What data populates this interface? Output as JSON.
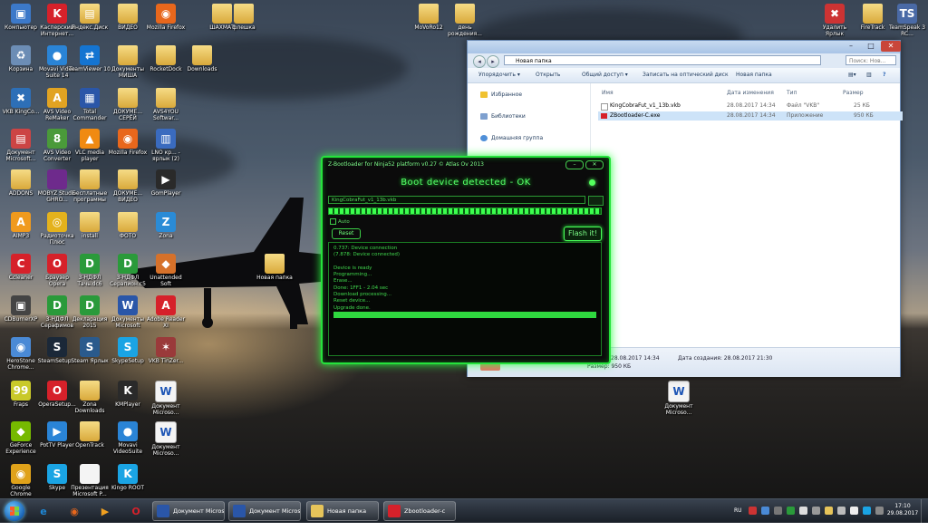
{
  "desktop": {
    "icons": [
      {
        "label": "Компьютер",
        "glyph": "▣",
        "color": "#3c79c9"
      },
      {
        "label": "Касперский Интернет...",
        "glyph": "K",
        "color": "#d6212a"
      },
      {
        "label": "Яндекс.Диск",
        "glyph": "▤",
        "color": "folder"
      },
      {
        "label": "ВИДЕО",
        "glyph": "",
        "color": "folder"
      },
      {
        "label": "Mozilla Firefox",
        "glyph": "◉",
        "color": "#e8671c"
      },
      {
        "label": "ШАХМАТ",
        "glyph": "",
        "color": "folder"
      },
      {
        "label": "флешка",
        "glyph": "",
        "color": "folder"
      },
      {
        "label": "MoVoRo12",
        "glyph": "",
        "color": "folder"
      },
      {
        "label": "день рождения...",
        "glyph": "",
        "color": "folder"
      },
      {
        "label": "Удалить Ярлык",
        "glyph": "✖",
        "color": "#c33"
      },
      {
        "label": "FireTrack",
        "glyph": "",
        "color": "folder"
      },
      {
        "label": "TeamSpeak 3 RC...",
        "glyph": "TS",
        "color": "#4a6aa6"
      },
      {
        "label": "Корзина",
        "glyph": "♻",
        "color": "#6c8db5"
      },
      {
        "label": "Movavi Video Suite 14",
        "glyph": "●",
        "color": "#2a84d6"
      },
      {
        "label": "TeamViewer 10",
        "glyph": "⇄",
        "color": "#1474d1"
      },
      {
        "label": "Документы МИША",
        "glyph": "",
        "color": "folder"
      },
      {
        "label": "RocketDock",
        "glyph": "",
        "color": "folder"
      },
      {
        "label": "Downloads",
        "glyph": "",
        "color": "folder"
      },
      {
        "label": "VKB KingCo...",
        "glyph": "✖",
        "color": "#2d6fb7"
      },
      {
        "label": "AVS Video ReMaker",
        "glyph": "A",
        "color": "#e1a322"
      },
      {
        "label": "Total Commander",
        "glyph": "▦",
        "color": "#2a56a8"
      },
      {
        "label": "ДОКУМЕ... СЕРЁЙ",
        "glyph": "",
        "color": "folder"
      },
      {
        "label": "AVS4YOU Softwar...",
        "glyph": "",
        "color": "folder"
      },
      {
        "label": "Документ Microsoft...",
        "glyph": "▤",
        "color": "#c44"
      },
      {
        "label": "AVS Video Converter",
        "glyph": "8",
        "color": "#4a9a3a"
      },
      {
        "label": "VLC media player",
        "glyph": "▲",
        "color": "#f08a12"
      },
      {
        "label": "Mozilla Firefox",
        "glyph": "◉",
        "color": "#e8671c"
      },
      {
        "label": "LNO кр... - ярлык (2)",
        "glyph": "▥",
        "color": "#3a6bbf"
      },
      {
        "label": "ADDONS",
        "glyph": "",
        "color": "folder"
      },
      {
        "label": "MOBYZ Studio GHRO...",
        "glyph": "",
        "color": "#6e2a8c"
      },
      {
        "label": "Бесплатные программы",
        "glyph": "",
        "color": "folder"
      },
      {
        "label": "ДОКУМЕ... ВИДЕО",
        "glyph": "",
        "color": "folder"
      },
      {
        "label": "GomPlayer",
        "glyph": "▶",
        "color": "#2a2a2a"
      },
      {
        "label": "AIMP3",
        "glyph": "A",
        "color": "#f09a1e"
      },
      {
        "label": "Радиоточка Плюс",
        "glyph": "◎",
        "color": "#e4b21d"
      },
      {
        "label": "install",
        "glyph": "",
        "color": "folder"
      },
      {
        "label": "ФОТО",
        "glyph": "",
        "color": "folder"
      },
      {
        "label": "Zona",
        "glyph": "Z",
        "color": "#2a8bd6"
      },
      {
        "label": "Ccleaner",
        "glyph": "C",
        "color": "#d6212a"
      },
      {
        "label": "Браузер Opera",
        "glyph": "O",
        "color": "#d6212a"
      },
      {
        "label": "3-НДФЛ Тачь.dc6",
        "glyph": "D",
        "color": "#2a9a3a"
      },
      {
        "label": "3-НДФЛ Серапион.с5",
        "glyph": "D",
        "color": "#2a9a3a"
      },
      {
        "label": "Unattended Soft",
        "glyph": "◆",
        "color": "#d6712a"
      },
      {
        "label": "Новая папка",
        "glyph": "",
        "color": "folder"
      },
      {
        "label": "CDBurnerXP",
        "glyph": "▣",
        "color": "#444"
      },
      {
        "label": "3-НДФЛ Серафимов",
        "glyph": "D",
        "color": "#2a9a3a"
      },
      {
        "label": "Декларация 2015",
        "glyph": "D",
        "color": "#2a9a3a"
      },
      {
        "label": "Документы Microsoft",
        "glyph": "W",
        "color": "#2a56a8"
      },
      {
        "label": "Adobe Reader XI",
        "glyph": "A",
        "color": "#d6212a"
      },
      {
        "label": "HeroStone Chrome...",
        "glyph": "◉",
        "color": "#4a8ad6"
      },
      {
        "label": "SteamSetup...",
        "glyph": "S",
        "color": "#1b2838"
      },
      {
        "label": "Steam Ярлык",
        "glyph": "S",
        "color": "#2a5a8c"
      },
      {
        "label": "SkypeSetup",
        "glyph": "S",
        "color": "#1aa4e4"
      },
      {
        "label": "VKB TinZer...",
        "glyph": "✶",
        "color": "#9a3a3a"
      },
      {
        "label": "Fraps",
        "glyph": "99",
        "color": "#c9c92a"
      },
      {
        "label": "OperaSetup...",
        "glyph": "O",
        "color": "#d6212a"
      },
      {
        "label": "Zona Downloads",
        "glyph": "",
        "color": "folder"
      },
      {
        "label": "KMPlayer",
        "glyph": "K",
        "color": "#2a2a2a"
      },
      {
        "label": "Документ Microso...",
        "glyph": "W",
        "color": "doc"
      },
      {
        "label": "Документ Microso...",
        "glyph": "W",
        "color": "doc"
      },
      {
        "label": "GeForce Experience",
        "glyph": "◆",
        "color": "#76b900"
      },
      {
        "label": "PotTV Player",
        "glyph": "▶",
        "color": "#2a84d6"
      },
      {
        "label": "OpenTrack",
        "glyph": "",
        "color": "folder"
      },
      {
        "label": "Movavi VideoSuite",
        "glyph": "●",
        "color": "#2a84d6"
      },
      {
        "label": "Документ Microso...",
        "glyph": "W",
        "color": "doc"
      },
      {
        "label": "Google Chrome",
        "glyph": "◉",
        "color": "#e0a21a"
      },
      {
        "label": "Skype",
        "glyph": "S",
        "color": "#1aa4e4"
      },
      {
        "label": "Презентация Microsoft P...",
        "glyph": "",
        "color": "#f4f4f4"
      },
      {
        "label": "Kingo ROOT",
        "glyph": "K",
        "color": "#1aa4e4"
      }
    ]
  },
  "explorer": {
    "address": "Новая папка",
    "search_placeholder": "Поиск: Нов...",
    "toolbar": [
      "Упорядочить ▾",
      "Открыть",
      "Общий доступ ▾",
      "Записать на оптический диск",
      "Новая папка"
    ],
    "nav": [
      "Избранное",
      "Библиотеки",
      "Домашняя группа"
    ],
    "columns": [
      "Имя",
      "Дата изменения",
      "Тип",
      "Размер"
    ],
    "files": [
      {
        "name": "KingCobraFut_v1_13b.vkb",
        "date": "28.08.2017 14:34",
        "type": "Файл \"VKB\"",
        "size": "25 КБ",
        "icon": "#eeeeee"
      },
      {
        "name": "ZBootloader-C.exe",
        "date": "28.08.2017 14:34",
        "type": "Приложение",
        "size": "950 КБ",
        "icon": "#d6212a"
      }
    ],
    "status": {
      "type": "Приложение",
      "size_label": "Размер: 950 КБ",
      "modified": "28.08.2017 14:34",
      "created_label": "Дата создания: 28.08.2017 21:30"
    }
  },
  "zboot": {
    "title": "Z-Bootloader for Ninja52 platform v0.27 © Atlas Ov 2013",
    "banner": "Boot device detected - OK",
    "file_path": "KingCobraFut_v1_13b.vkb",
    "progress": 1.0,
    "checkbox_label": "Auto",
    "reset_label": "Reset",
    "flash_label": "Flash it!",
    "log": [
      "0.737: Device connection",
      "  (7.878: Device connected)",
      "",
      "Device is ready",
      "Programming...",
      "Erase...",
      "Done: 1FF1 - 2.04 sec",
      "Download processing...",
      "Reset device...",
      "Upgrade done.",
      ""
    ],
    "selected_line": 10
  },
  "taskbar": {
    "pinned": [
      {
        "name": "ie-icon",
        "glyph": "e",
        "color": "#1e88d8"
      },
      {
        "name": "firefox-icon",
        "glyph": "◉",
        "color": "#e8671c"
      },
      {
        "name": "media-player-icon",
        "glyph": "▶",
        "color": "#f0a020"
      },
      {
        "name": "opera-icon",
        "glyph": "O",
        "color": "#d6212a"
      }
    ],
    "buttons": [
      {
        "label": "Документ Microso...",
        "color": "#2a56a8"
      },
      {
        "label": "Документ Microso...",
        "color": "#2a56a8"
      },
      {
        "label": "Новая папка",
        "color": "#e6c45a"
      },
      {
        "label": "Zbootloader-c",
        "color": "#d6212a"
      }
    ],
    "lang": "RU",
    "time": "17:10",
    "date": "29.08.2017"
  }
}
